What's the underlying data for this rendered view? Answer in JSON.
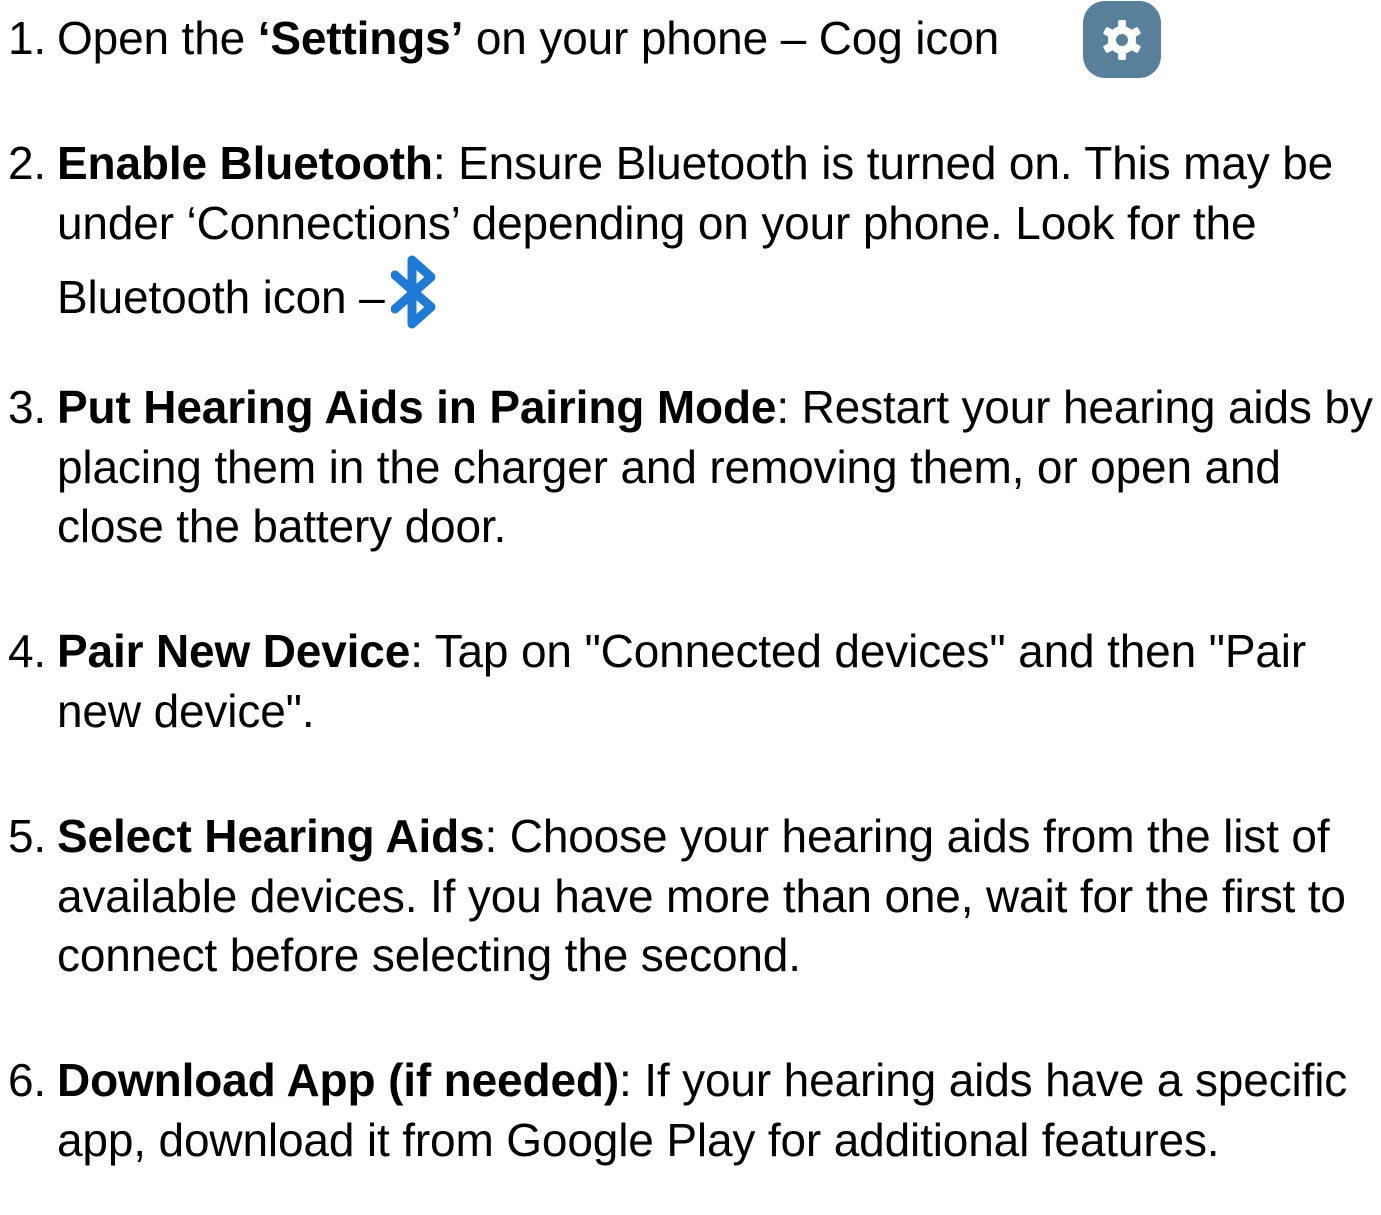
{
  "steps": [
    {
      "number": "1.",
      "pre": "Open the ",
      "bold": "‘Settings’",
      "text": " on your phone – Cog icon",
      "icon": "gear-icon",
      "icon_bg": "#58809a"
    },
    {
      "number": "2.",
      "bold": "Enable Bluetooth",
      "text": ": Ensure Bluetooth is turned on. This may be under ‘Connections’ depending on your phone. Look for the Bluetooth icon –",
      "icon": "bluetooth-icon",
      "icon_color": "#1f7ad6"
    },
    {
      "number": "3.",
      "bold": "Put Hearing Aids in Pairing Mode",
      "text": ": Restart your hearing aids by placing them in the charger and removing them, or open and close the battery door."
    },
    {
      "number": "4.",
      "bold": "Pair New Device",
      "text": ": Tap on \"Connected devices\" and then \"Pair new device\"."
    },
    {
      "number": "5.",
      "bold": "Select Hearing Aids",
      "text": ": Choose your hearing aids from the list of available devices. If you have more than one, wait for the first to connect before selecting the second."
    },
    {
      "number": "6.",
      "bold": "Download App (if needed)",
      "text": ": If your hearing aids have a specific app, download it from Google Play for additional features."
    }
  ]
}
